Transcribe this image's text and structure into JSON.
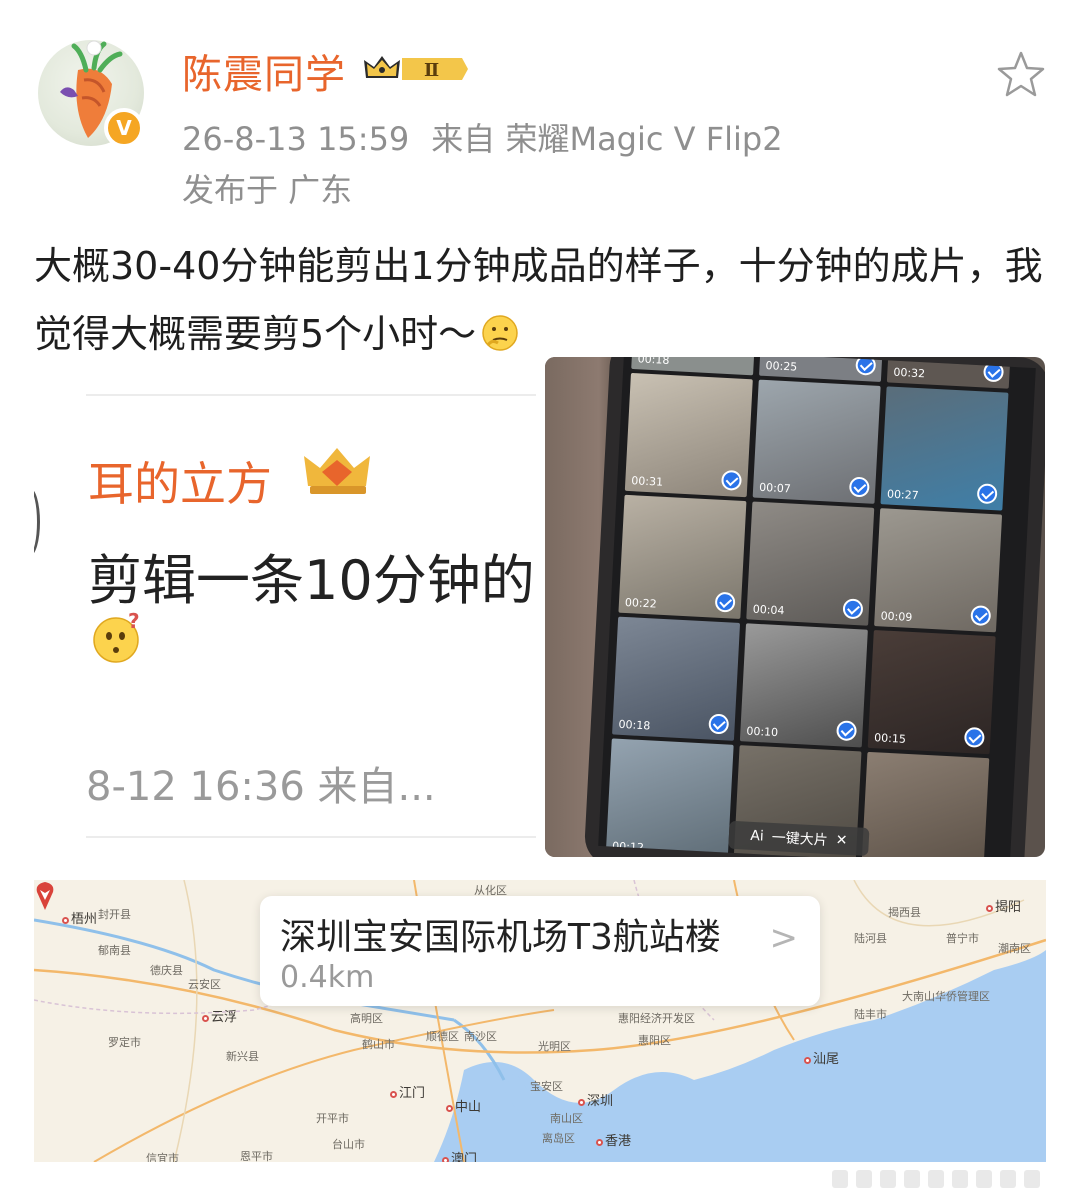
{
  "post": {
    "author": "陈震同学",
    "time": "26-8-13 15:59",
    "source": "来自 荣耀Magic V Flip2",
    "location": "发布于 广东",
    "text": "大概30-40分钟能剪出1分钟成品的样子，十分钟的成片，我觉得大概需要剪5个小时～"
  },
  "badges": {
    "membership_level": "Ⅱ"
  },
  "quoted_screenshot": {
    "author": "耳的立方",
    "text": "剪辑一条10分钟的",
    "time": "8-12 16:36 来自..."
  },
  "photo": {
    "tiles": [
      {
        "duration": "00:18"
      },
      {
        "duration": "00:25"
      },
      {
        "duration": "00:32"
      },
      {
        "duration": "00:31"
      },
      {
        "duration": "00:07"
      },
      {
        "duration": "00:27"
      },
      {
        "duration": "00:22"
      },
      {
        "duration": "00:04"
      },
      {
        "duration": "00:09"
      },
      {
        "duration": "00:18"
      },
      {
        "duration": "00:10"
      },
      {
        "duration": "00:15"
      },
      {
        "duration": "00:12"
      },
      {
        "duration": ""
      },
      {
        "duration": ""
      }
    ],
    "ai_button_label": "一键大片",
    "ai_tag": "Ai"
  },
  "map": {
    "place_name": "深圳宝安国际机场T3航站楼",
    "distance": "0.4km",
    "labels": {
      "conghua": "从化区",
      "wuzhou": "梧州",
      "fengkai": "封开县",
      "fengshun": "揭西县",
      "jieyang": "揭阳",
      "denan": "郁南县",
      "deqing": "德庆县",
      "yunan": "云安区",
      "luhe": "陆河县",
      "puning": "普宁市",
      "chaonan": "潮南区",
      "yunfu": "云浮",
      "dananshan": "大南山华侨管理区",
      "gaoming": "高明区",
      "heshan": "鹤山市",
      "shunde": "顺德区",
      "nansha": "南沙区",
      "guangming": "光明区",
      "huiyang": "惠阳经济开发区",
      "huiyangqu": "惠阳区",
      "lufeng": "陆丰市",
      "shanwei": "汕尾",
      "luoding": "罗定市",
      "xinxing": "新兴县",
      "jiangmen": "江门",
      "zhongshan": "中山",
      "baoan": "宝安区",
      "shenzhen": "深圳",
      "nanshan": "南山区",
      "lidao": "离岛区",
      "hongkong": "香港",
      "kaiping": "开平市",
      "taishan": "台山市",
      "macau": "澳门",
      "xinyi": "信宜市",
      "enping": "恩平市"
    }
  },
  "colors": {
    "username": "#e8652c",
    "meta": "#8f8f8f",
    "check_blue": "#2a73e8",
    "map_land": "#f6f1e6",
    "map_sea": "#a9cdf2"
  },
  "icons": [
    "avatar",
    "verified-icon",
    "crown-badge-icon",
    "star-icon",
    "thinking-emoji-icon",
    "confused-emoji-icon",
    "location-pin-icon",
    "chevron-right-icon"
  ]
}
